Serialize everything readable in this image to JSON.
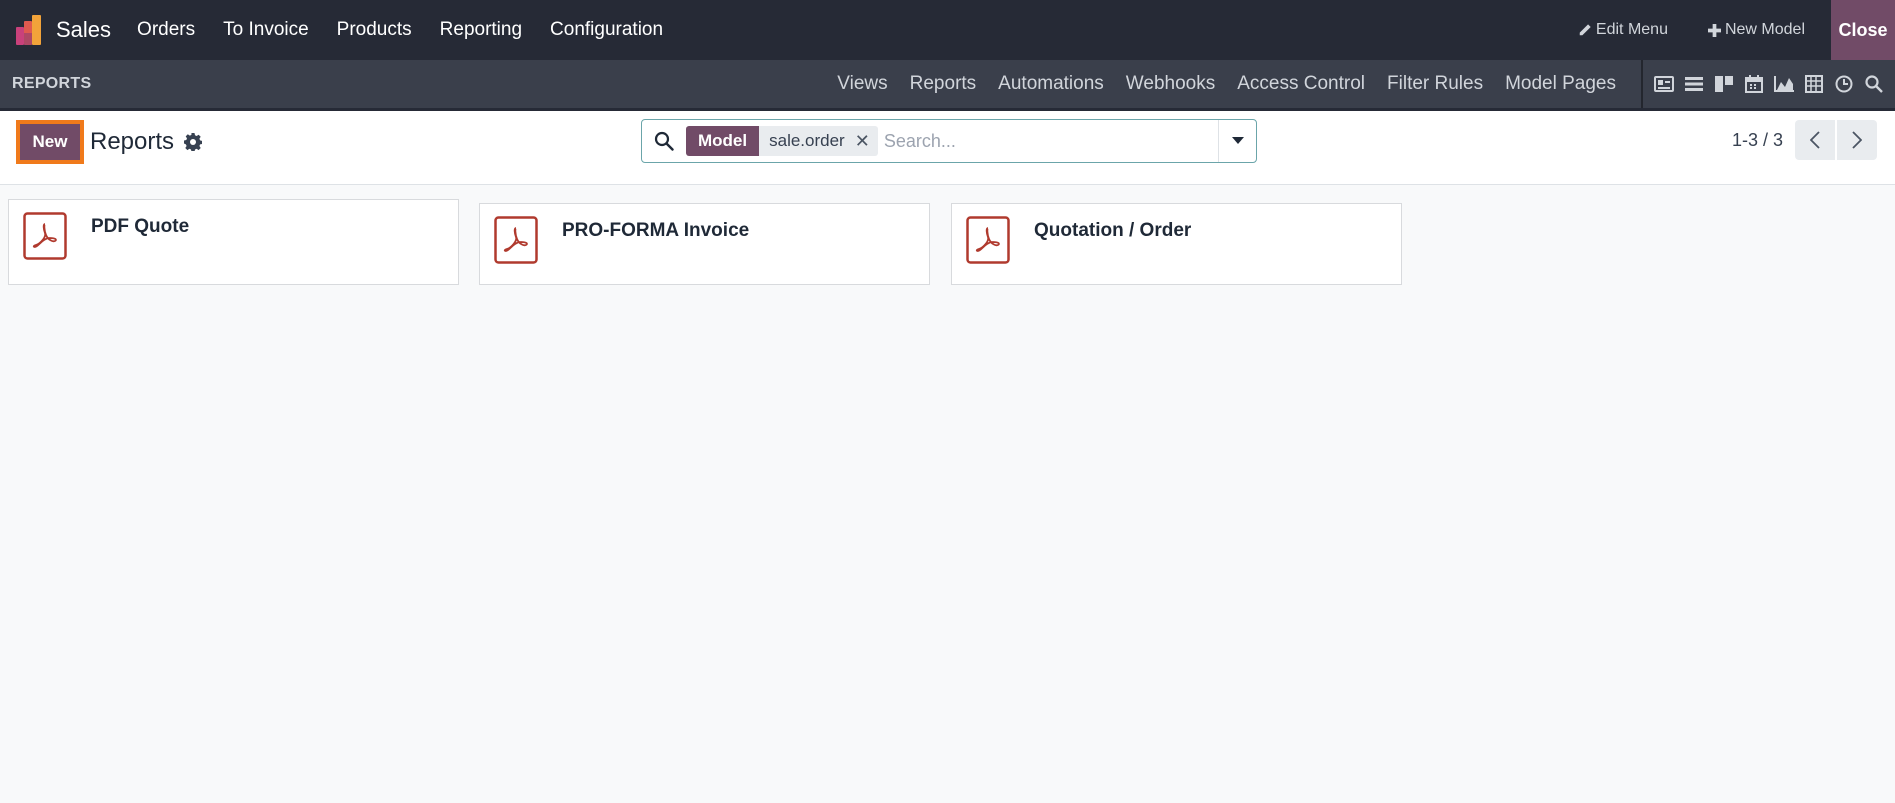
{
  "topbar": {
    "app_name": "Sales",
    "menu": [
      "Orders",
      "To Invoice",
      "Products",
      "Reporting",
      "Configuration"
    ],
    "edit_menu_label": "Edit Menu",
    "new_model_label": "New Model",
    "close_label": "Close"
  },
  "subbar": {
    "section_title": "REPORTS",
    "tabs": [
      "Views",
      "Reports",
      "Automations",
      "Webhooks",
      "Access Control",
      "Filter Rules",
      "Model Pages"
    ],
    "view_icons": [
      "form-view-icon",
      "list-view-icon",
      "kanban-view-icon",
      "calendar-view-icon",
      "graph-view-icon",
      "pivot-view-icon",
      "activity-view-icon",
      "search-view-icon"
    ]
  },
  "control_panel": {
    "new_label": "New",
    "title": "Reports",
    "search": {
      "facet_label": "Model",
      "facet_value": "sale.order",
      "placeholder": "Search..."
    },
    "pager": "1-3 / 3"
  },
  "reports": [
    {
      "name": "PDF Quote"
    },
    {
      "name": "PRO-FORMA Invoice"
    },
    {
      "name": "Quotation / Order"
    }
  ],
  "colors": {
    "navbar": "#262a36",
    "subbar": "#3a3f4b",
    "brand": "#714b67",
    "highlight": "#f07a1b",
    "pdf_red": "#b03a2e"
  }
}
